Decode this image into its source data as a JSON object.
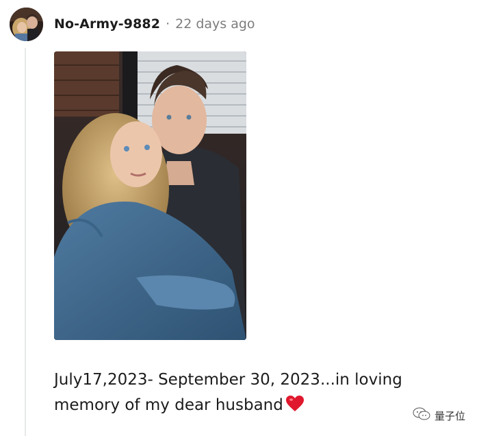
{
  "comment": {
    "author": "No-Army-9882",
    "separator": "·",
    "timestamp": "22 days ago",
    "text": "July17,2023- September 30, 2023...in loving memory of my dear husband",
    "emoji": "heart"
  },
  "watermark": {
    "text": "量子位",
    "icon": "wechat-icon"
  },
  "colors": {
    "username": "#1c1c1c",
    "meta": "#7c7c7c",
    "thread_line": "#e6e8ea",
    "heart": "#e0182d"
  }
}
